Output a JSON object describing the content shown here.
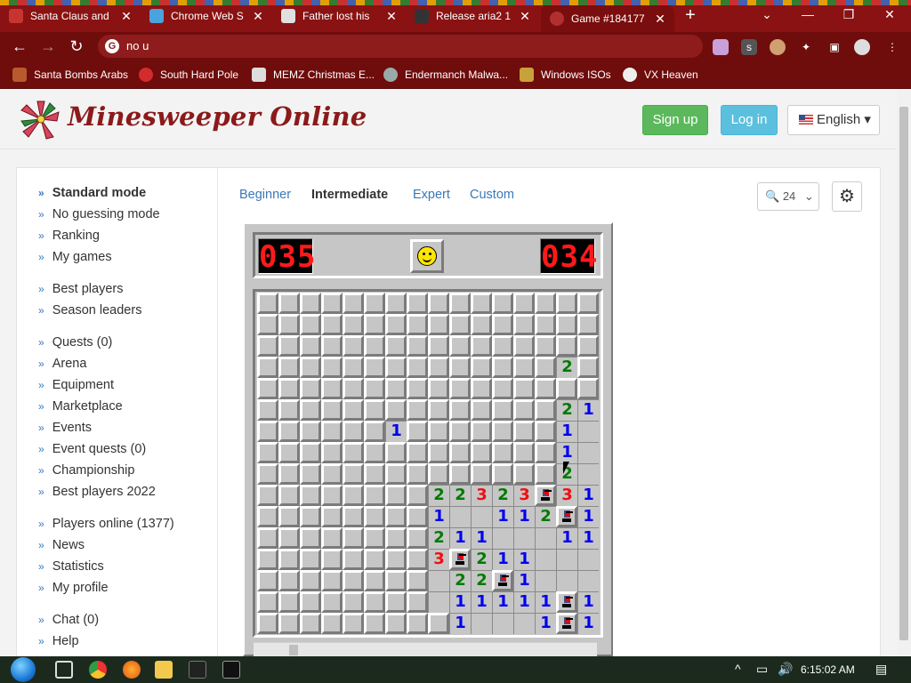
{
  "browser": {
    "tabs": [
      {
        "title": "Santa Claus and",
        "close": "✕"
      },
      {
        "title": "Chrome Web S",
        "close": "✕"
      },
      {
        "title": "Father lost his",
        "close": "✕"
      },
      {
        "title": "Release aria2 1",
        "close": "✕"
      },
      {
        "title": "Game #184177",
        "close": "✕"
      }
    ],
    "new_tab": "+",
    "address": "no u",
    "bookmarks": [
      {
        "label": "Santa Bombs Arabs"
      },
      {
        "label": "South Hard Pole"
      },
      {
        "label": "MEMZ Christmas E..."
      },
      {
        "label": "Endermanch Malwa..."
      },
      {
        "label": "Windows ISOs"
      },
      {
        "label": "VX Heaven"
      }
    ],
    "theme_color": "#8a1212"
  },
  "header": {
    "logo_text": "Minesweeper Online",
    "signup": "Sign up",
    "login": "Log in",
    "language": "English ▾"
  },
  "sidebar": {
    "groups": [
      [
        {
          "label": "Standard mode",
          "active": true
        },
        {
          "label": "No guessing mode"
        },
        {
          "label": "Ranking"
        },
        {
          "label": "My games"
        }
      ],
      [
        {
          "label": "Best players"
        },
        {
          "label": "Season leaders"
        }
      ],
      [
        {
          "label": "Quests (0)"
        },
        {
          "label": "Arena"
        },
        {
          "label": "Equipment"
        },
        {
          "label": "Marketplace"
        },
        {
          "label": "Events"
        },
        {
          "label": "Event quests (0)"
        },
        {
          "label": "Championship"
        },
        {
          "label": "Best players 2022"
        }
      ],
      [
        {
          "label": "Players online (1377)"
        },
        {
          "label": "News"
        },
        {
          "label": "Statistics"
        },
        {
          "label": "My profile"
        }
      ],
      [
        {
          "label": "Chat (0)"
        },
        {
          "label": "Help"
        }
      ]
    ]
  },
  "levels": {
    "tabs": [
      "Beginner",
      "Intermediate",
      "Expert",
      "Custom"
    ],
    "current": "Intermediate"
  },
  "controls": {
    "zoom": "24",
    "zoom_icon": "magnifier-icon",
    "settings_icon": "gear-icon"
  },
  "game": {
    "mines_counter": "035",
    "timer": "034",
    "face": "smiley",
    "board": [
      "################",
      "################",
      "################",
      "##############2#",
      "################",
      "##############21",
      "######1#######1.",
      "##############1.",
      "##############2.",
      "########22323F31",
      "########1..112F1",
      "########211...11",
      "########3F211...",
      "########.22F1...",
      "########.11111F1",
      "#########1...1F1"
    ],
    "legend": {
      "#": "closed",
      ".": "open-empty",
      "F": "flag",
      "1-8": "number"
    }
  },
  "taskbar": {
    "clock": "6:15:02 AM"
  }
}
